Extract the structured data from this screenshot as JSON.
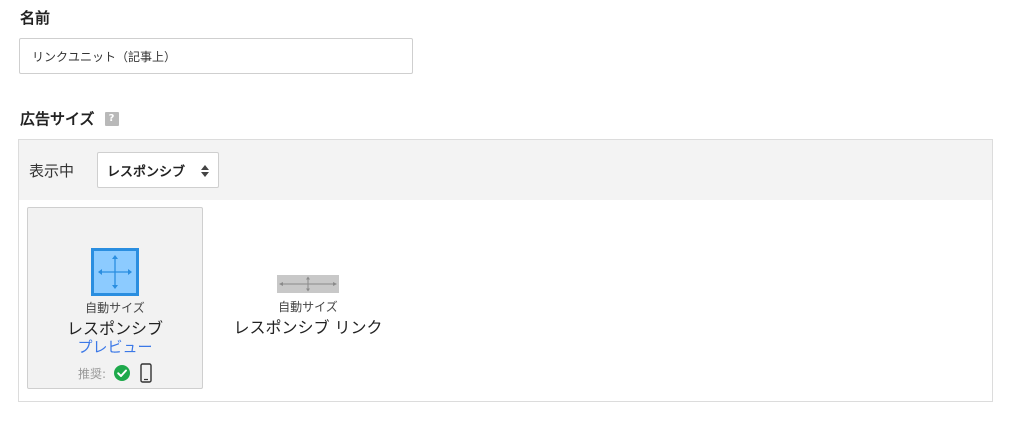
{
  "name_section": {
    "label": "名前",
    "input_value": "リンクユニット（記事上）"
  },
  "adsize_section": {
    "label": "広告サイズ",
    "help_icon": "?"
  },
  "panel": {
    "showing_label": "表示中",
    "select_value": "レスポンシブ"
  },
  "options": [
    {
      "sublabel": "自動サイズ",
      "label": "レスポンシブ",
      "preview_link": "プレビュー",
      "recommend_label": "推奨:",
      "selected": true
    },
    {
      "sublabel": "自動サイズ",
      "label": "レスポンシブ リンク",
      "selected": false
    }
  ],
  "colors": {
    "accent_blue": "#3b78e7",
    "icon_blue_fill": "#8ccbff",
    "icon_blue_border": "#2a8ee0",
    "check_green": "#1ea94b"
  }
}
